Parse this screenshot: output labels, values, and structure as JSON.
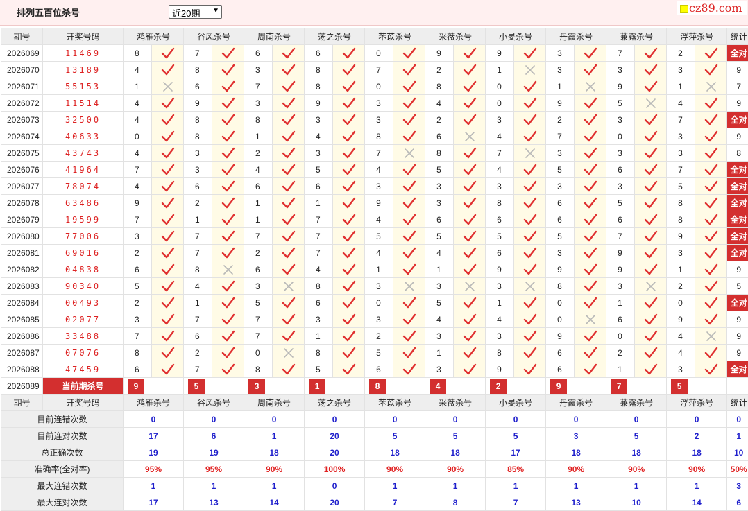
{
  "header": {
    "title": "排列五百位杀号",
    "period_select": "近20期",
    "logo_text": "cz89.com"
  },
  "columns": {
    "issue": "期号",
    "draw": "开奖号码",
    "experts": [
      "鸿雁杀号",
      "谷风杀号",
      "周南杀号",
      "荡之杀号",
      "芣苡杀号",
      "采薇杀号",
      "小旻杀号",
      "丹霞杀号",
      "蒹露杀号",
      "浮萍杀号"
    ],
    "stats": "统计"
  },
  "rows": [
    {
      "issue": "2026069",
      "draw": "11469",
      "picks": [
        8,
        7,
        6,
        6,
        0,
        9,
        9,
        3,
        7,
        2
      ],
      "hits": [
        1,
        1,
        1,
        1,
        1,
        1,
        1,
        1,
        1,
        1
      ],
      "stat": "全对"
    },
    {
      "issue": "2026070",
      "draw": "13189",
      "picks": [
        4,
        8,
        3,
        8,
        7,
        2,
        1,
        3,
        3,
        3
      ],
      "hits": [
        1,
        1,
        1,
        1,
        1,
        1,
        0,
        1,
        1,
        1
      ],
      "stat": "9"
    },
    {
      "issue": "2026071",
      "draw": "55153",
      "picks": [
        1,
        6,
        7,
        8,
        0,
        8,
        0,
        1,
        9,
        1
      ],
      "hits": [
        0,
        1,
        1,
        1,
        1,
        1,
        1,
        0,
        1,
        0
      ],
      "stat": "7"
    },
    {
      "issue": "2026072",
      "draw": "11514",
      "picks": [
        4,
        9,
        3,
        9,
        3,
        4,
        0,
        9,
        5,
        4
      ],
      "hits": [
        1,
        1,
        1,
        1,
        1,
        1,
        1,
        1,
        0,
        1
      ],
      "stat": "9"
    },
    {
      "issue": "2026073",
      "draw": "32500",
      "picks": [
        4,
        8,
        8,
        3,
        3,
        2,
        3,
        2,
        3,
        7
      ],
      "hits": [
        1,
        1,
        1,
        1,
        1,
        1,
        1,
        1,
        1,
        1
      ],
      "stat": "全对"
    },
    {
      "issue": "2026074",
      "draw": "40633",
      "picks": [
        0,
        8,
        1,
        4,
        8,
        6,
        4,
        7,
        0,
        3
      ],
      "hits": [
        1,
        1,
        1,
        1,
        1,
        0,
        1,
        1,
        1,
        1
      ],
      "stat": "9"
    },
    {
      "issue": "2026075",
      "draw": "43743",
      "picks": [
        4,
        3,
        2,
        3,
        7,
        8,
        7,
        3,
        3,
        3
      ],
      "hits": [
        1,
        1,
        1,
        1,
        0,
        1,
        0,
        1,
        1,
        1
      ],
      "stat": "8"
    },
    {
      "issue": "2026076",
      "draw": "41964",
      "picks": [
        7,
        3,
        4,
        5,
        4,
        5,
        4,
        5,
        6,
        7
      ],
      "hits": [
        1,
        1,
        1,
        1,
        1,
        1,
        1,
        1,
        1,
        1
      ],
      "stat": "全对"
    },
    {
      "issue": "2026077",
      "draw": "78074",
      "picks": [
        4,
        6,
        6,
        6,
        3,
        3,
        3,
        3,
        3,
        5
      ],
      "hits": [
        1,
        1,
        1,
        1,
        1,
        1,
        1,
        1,
        1,
        1
      ],
      "stat": "全对"
    },
    {
      "issue": "2026078",
      "draw": "63486",
      "picks": [
        9,
        2,
        1,
        1,
        9,
        3,
        8,
        6,
        5,
        8
      ],
      "hits": [
        1,
        1,
        1,
        1,
        1,
        1,
        1,
        1,
        1,
        1
      ],
      "stat": "全对"
    },
    {
      "issue": "2026079",
      "draw": "19599",
      "picks": [
        7,
        1,
        1,
        7,
        4,
        6,
        6,
        6,
        6,
        8
      ],
      "hits": [
        1,
        1,
        1,
        1,
        1,
        1,
        1,
        1,
        1,
        1
      ],
      "stat": "全对"
    },
    {
      "issue": "2026080",
      "draw": "77006",
      "picks": [
        3,
        7,
        7,
        7,
        5,
        5,
        5,
        5,
        7,
        9
      ],
      "hits": [
        1,
        1,
        1,
        1,
        1,
        1,
        1,
        1,
        1,
        1
      ],
      "stat": "全对"
    },
    {
      "issue": "2026081",
      "draw": "69016",
      "picks": [
        2,
        7,
        2,
        7,
        4,
        4,
        6,
        3,
        9,
        3
      ],
      "hits": [
        1,
        1,
        1,
        1,
        1,
        1,
        1,
        1,
        1,
        1
      ],
      "stat": "全对"
    },
    {
      "issue": "2026082",
      "draw": "04838",
      "picks": [
        6,
        8,
        6,
        4,
        1,
        1,
        9,
        9,
        9,
        1
      ],
      "hits": [
        1,
        0,
        1,
        1,
        1,
        1,
        1,
        1,
        1,
        1
      ],
      "stat": "9"
    },
    {
      "issue": "2026083",
      "draw": "90340",
      "picks": [
        5,
        4,
        3,
        8,
        3,
        3,
        3,
        8,
        3,
        2
      ],
      "hits": [
        1,
        1,
        0,
        1,
        0,
        0,
        0,
        1,
        0,
        1
      ],
      "stat": "5"
    },
    {
      "issue": "2026084",
      "draw": "00493",
      "picks": [
        2,
        1,
        5,
        6,
        0,
        5,
        1,
        0,
        1,
        0
      ],
      "hits": [
        1,
        1,
        1,
        1,
        1,
        1,
        1,
        1,
        1,
        1
      ],
      "stat": "全对"
    },
    {
      "issue": "2026085",
      "draw": "02077",
      "picks": [
        3,
        7,
        7,
        3,
        3,
        4,
        4,
        0,
        6,
        9
      ],
      "hits": [
        1,
        1,
        1,
        1,
        1,
        1,
        1,
        0,
        1,
        1
      ],
      "stat": "9"
    },
    {
      "issue": "2026086",
      "draw": "33488",
      "picks": [
        7,
        6,
        7,
        1,
        2,
        3,
        3,
        9,
        0,
        4
      ],
      "hits": [
        1,
        1,
        1,
        1,
        1,
        1,
        1,
        1,
        1,
        0
      ],
      "stat": "9"
    },
    {
      "issue": "2026087",
      "draw": "07076",
      "picks": [
        8,
        2,
        0,
        8,
        5,
        1,
        8,
        6,
        2,
        4
      ],
      "hits": [
        1,
        1,
        0,
        1,
        1,
        1,
        1,
        1,
        1,
        1
      ],
      "stat": "9"
    },
    {
      "issue": "2026088",
      "draw": "47459",
      "picks": [
        6,
        7,
        8,
        5,
        6,
        3,
        9,
        6,
        1,
        3
      ],
      "hits": [
        1,
        1,
        1,
        1,
        1,
        1,
        1,
        1,
        1,
        1
      ],
      "stat": "全对"
    }
  ],
  "current": {
    "issue": "2026089",
    "label": "当前期杀号",
    "picks": [
      9,
      5,
      3,
      1,
      8,
      4,
      2,
      9,
      7,
      5
    ]
  },
  "summary": [
    {
      "label": "目前连错次数",
      "values": [
        "0",
        "0",
        "0",
        "0",
        "0",
        "0",
        "0",
        "0",
        "0",
        "0"
      ],
      "stat": "0",
      "style": "val"
    },
    {
      "label": "目前连对次数",
      "values": [
        "17",
        "6",
        "1",
        "20",
        "5",
        "5",
        "5",
        "3",
        "5",
        "2"
      ],
      "stat": "1",
      "style": "val"
    },
    {
      "label": "总正确次数",
      "values": [
        "19",
        "19",
        "18",
        "20",
        "18",
        "18",
        "17",
        "18",
        "18",
        "18"
      ],
      "stat": "10",
      "style": "val"
    },
    {
      "label": "准确率(全对率)",
      "values": [
        "95%",
        "95%",
        "90%",
        "100%",
        "90%",
        "90%",
        "85%",
        "90%",
        "90%",
        "90%"
      ],
      "stat": "50%",
      "style": "pct"
    },
    {
      "label": "最大连错次数",
      "values": [
        "1",
        "1",
        "1",
        "0",
        "1",
        "1",
        "1",
        "1",
        "1",
        "1"
      ],
      "stat": "3",
      "style": "val"
    },
    {
      "label": "最大连对次数",
      "values": [
        "17",
        "13",
        "14",
        "20",
        "7",
        "8",
        "7",
        "13",
        "10",
        "14"
      ],
      "stat": "6",
      "style": "val"
    }
  ],
  "colors": {
    "accent_red": "#d32f2f",
    "check_red": "#e03030",
    "cross_gray": "#b8b8b8",
    "summary_blue": "#1f1fcc",
    "header_bg": "#eeeeee",
    "mark_bg": "#fffbe6"
  },
  "icons": {
    "hit": "check-icon",
    "miss": "cross-icon"
  }
}
